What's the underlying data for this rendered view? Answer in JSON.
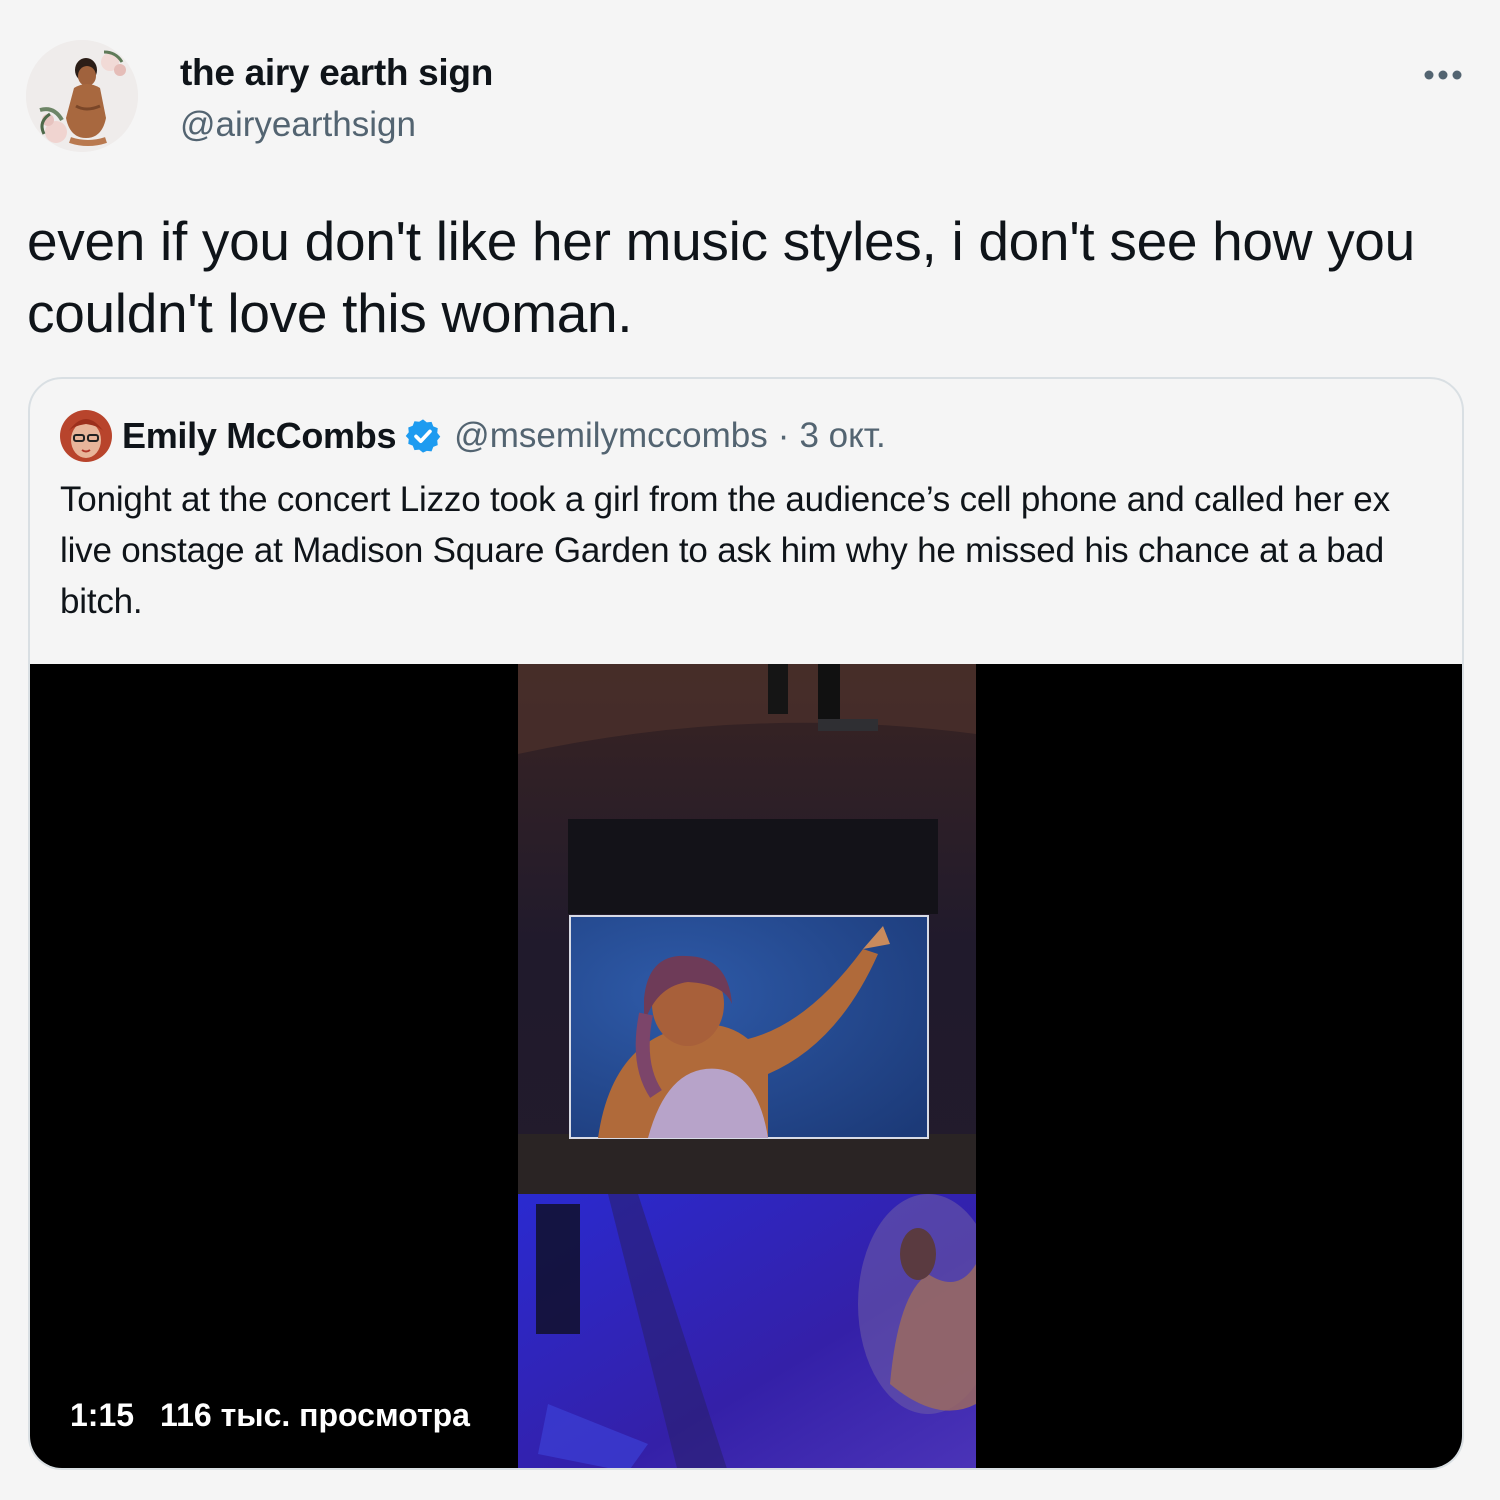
{
  "tweet": {
    "display_name": "the airy earth sign",
    "handle": "@airyearthsign",
    "text": "even if you don't like her music styles, i don't see how you couldn't love this woman.",
    "avatar_icon": "user-avatar",
    "more_icon": "more-horizontal-icon"
  },
  "quoted": {
    "display_name": "Emily McCombs",
    "verified_icon": "verified-badge-icon",
    "handle": "@msemilymccombs",
    "separator": "·",
    "date": "3 окт.",
    "text": "Tonight at the concert Lizzo took a girl from the audience’s cell phone and called her ex live onstage at Madison Square Garden to ask him why he missed his chance at a bad bitch.",
    "video": {
      "duration": "1:15",
      "views": "116 тыс. просмотра"
    }
  },
  "colors": {
    "background": "#f5f5f5",
    "text": "#0f1419",
    "secondary_text": "#536471",
    "verified": "#1d9bf0",
    "card_border": "#d9dfe3",
    "video_bg": "#000000"
  }
}
